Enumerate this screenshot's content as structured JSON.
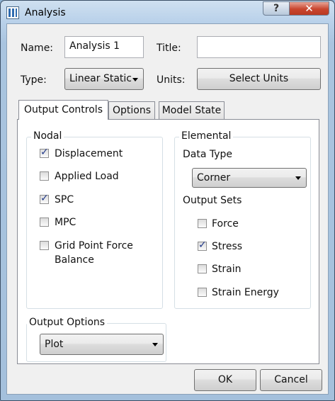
{
  "window": {
    "title": "Analysis",
    "help_glyph": "?",
    "close_glyph": "✕"
  },
  "form": {
    "name_label": "Name:",
    "name_value": "Analysis 1",
    "title_label": "Title:",
    "title_value": "",
    "type_label": "Type:",
    "type_value": "Linear Static",
    "units_label": "Units:",
    "select_units_button": "Select Units"
  },
  "tabs": [
    {
      "label": "Output Controls"
    },
    {
      "label": "Options"
    },
    {
      "label": "Model State"
    }
  ],
  "nodal": {
    "legend": "Nodal",
    "items": [
      {
        "label": "Displacement",
        "checked": true
      },
      {
        "label": "Applied Load",
        "checked": false
      },
      {
        "label": "SPC",
        "checked": true
      },
      {
        "label": "MPC",
        "checked": false
      },
      {
        "label": "Grid Point Force",
        "label2": "Balance",
        "checked": false
      }
    ]
  },
  "elemental": {
    "legend": "Elemental",
    "data_type_label": "Data Type",
    "data_type_value": "Corner",
    "output_sets_label": "Output Sets",
    "items": [
      {
        "label": "Force",
        "checked": false
      },
      {
        "label": "Stress",
        "checked": true
      },
      {
        "label": "Strain",
        "checked": false
      },
      {
        "label": "Strain Energy",
        "checked": false
      }
    ]
  },
  "output_options": {
    "legend": "Output Options",
    "value": "Plot"
  },
  "footer": {
    "ok": "OK",
    "cancel": "Cancel"
  },
  "check_glyph": "✓"
}
